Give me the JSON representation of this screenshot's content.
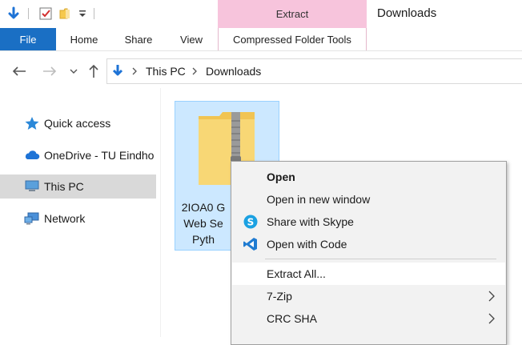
{
  "window": {
    "title": "Downloads"
  },
  "context_tab": {
    "label": "Extract"
  },
  "ribbon": {
    "tabs": [
      {
        "label": "File"
      },
      {
        "label": "Home"
      },
      {
        "label": "Share"
      },
      {
        "label": "View"
      },
      {
        "label": "Compressed Folder Tools"
      }
    ]
  },
  "address": {
    "crumbs": [
      "This PC",
      "Downloads"
    ]
  },
  "nav": {
    "items": [
      {
        "label": "Quick access",
        "icon": "star-icon"
      },
      {
        "label": "OneDrive - TU Eindho",
        "icon": "cloud-icon"
      },
      {
        "label": "This PC",
        "icon": "computer-icon"
      },
      {
        "label": "Network",
        "icon": "network-icon"
      }
    ]
  },
  "file": {
    "name_lines": [
      "2IOA0 G",
      "Web Se",
      "Pyth"
    ]
  },
  "context_menu": {
    "items": [
      {
        "label": "Open",
        "bold": true
      },
      {
        "label": "Open in new window"
      },
      {
        "label": "Share with Skype",
        "icon": "skype-icon"
      },
      {
        "label": "Open with Code",
        "icon": "vscode-icon"
      },
      {
        "label": "Extract All..."
      },
      {
        "label": "7-Zip",
        "submenu": true
      },
      {
        "label": "CRC SHA",
        "submenu": true
      }
    ]
  },
  "colors": {
    "file_tab": "#1a6fc4",
    "context_tab": "#f7c4dc",
    "selection": "#cce8ff"
  }
}
